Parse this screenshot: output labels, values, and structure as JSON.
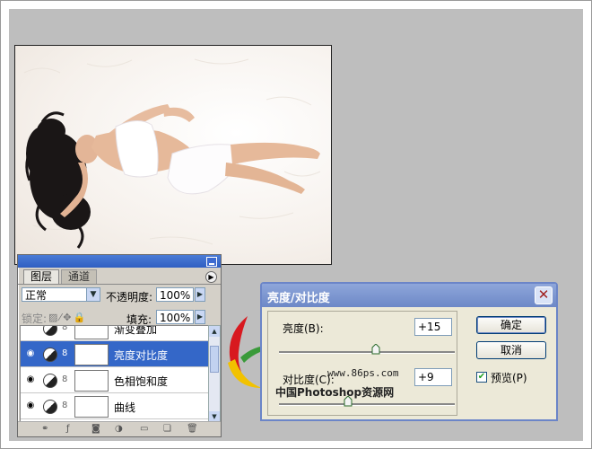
{
  "layers_panel": {
    "tabs": [
      "图层",
      "通道"
    ],
    "blend_mode": "正常",
    "opacity_label": "不透明度:",
    "opacity_value": "100%",
    "lock_label": "锁定:",
    "fill_label": "填充:",
    "fill_value": "100%",
    "layers": [
      {
        "name": "渐变叠加",
        "visible": false,
        "selected": false
      },
      {
        "name": "亮度对比度",
        "visible": true,
        "selected": true
      },
      {
        "name": "色相饱和度",
        "visible": true,
        "selected": false
      },
      {
        "name": "曲线",
        "visible": true,
        "selected": false
      }
    ]
  },
  "dialog": {
    "title": "亮度/对比度",
    "brightness_label": "亮度(B):",
    "brightness_value": "+15",
    "brightness_level": 15,
    "contrast_label": "对比度(C):",
    "contrast_value": "+9",
    "contrast_level": 9,
    "ok_label": "确定",
    "cancel_label": "取消",
    "preview_label": "预览(P)",
    "preview_checked": true
  },
  "watermark": {
    "url": "www.86ps.com",
    "site": "中国Photoshop资源网",
    "logo_text": "86"
  },
  "colors": {
    "selection": "#3467c8",
    "canvas_bg": "#bebebe",
    "dialog_title": "#7590cc"
  }
}
